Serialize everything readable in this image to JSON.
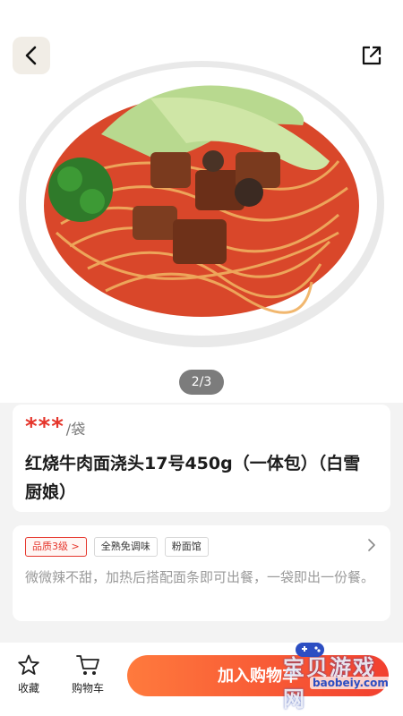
{
  "hero": {
    "pager": "2/3"
  },
  "product": {
    "price_masked": "***",
    "unit": "/袋",
    "title": "红烧牛肉面浇头17号450g（一体包）（白雪厨娘）"
  },
  "info": {
    "tags": [
      "品质3级 >",
      "全熟免调味",
      "粉面馆"
    ],
    "description": "微微辣不甜，加热后搭配面条即可出餐，一袋即出一份餐。"
  },
  "bottom_bar": {
    "favorite_label": "收藏",
    "cart_label": "购物车",
    "add_to_cart_label": "加入购物车"
  },
  "watermark": {
    "text": "宝贝游戏网",
    "url": "baobeiy.com"
  },
  "colors": {
    "accent_red": "#e5352b",
    "button_gradient_start": "#ff7a3d",
    "button_gradient_end": "#f2402f"
  }
}
